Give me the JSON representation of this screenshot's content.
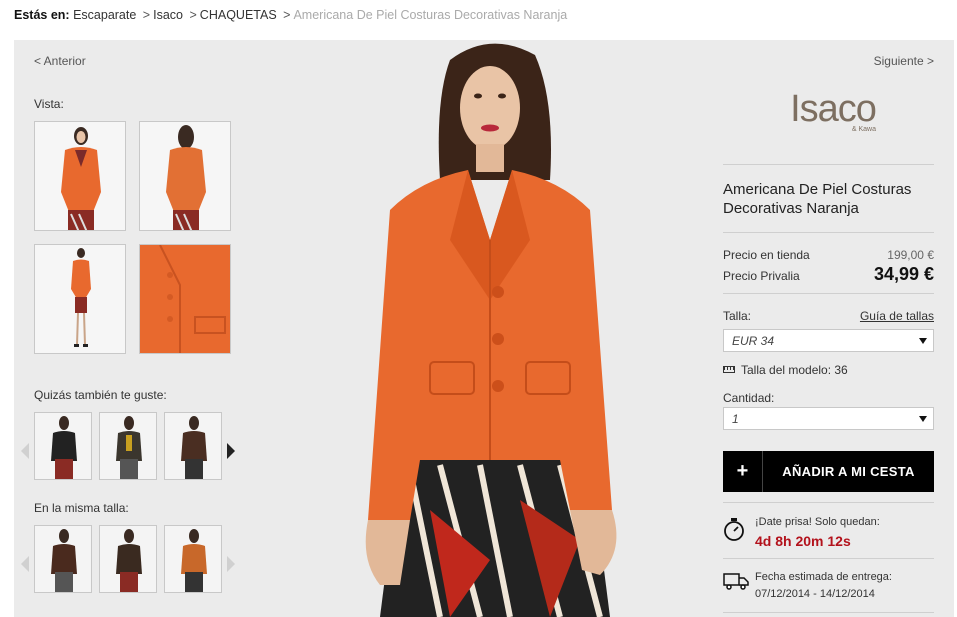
{
  "breadcrumb": {
    "prefix": "Estás en:",
    "items": [
      "Escaparate",
      "Isaco",
      "CHAQUETAS"
    ],
    "current": "Americana De Piel Costuras Decorativas Naranja",
    "separator": ">"
  },
  "nav": {
    "prev": "< Anterior",
    "next": "Siguiente >"
  },
  "gallery": {
    "label": "Vista:",
    "thumbnails": [
      "front-view",
      "back-view",
      "full-body-view",
      "detail-view"
    ]
  },
  "recommendations": {
    "label": "Quizás también te guste:",
    "items": [
      "black-jacket",
      "dark-jacket",
      "brown-jacket"
    ]
  },
  "same_size": {
    "label": "En la misma talla:",
    "items": [
      "brown-jacket",
      "dark-brown-jacket",
      "orange-jacket"
    ]
  },
  "brand": {
    "name": "Isaco",
    "sub": "& Kawa"
  },
  "product": {
    "title": "Americana De Piel Costuras Decorativas Naranja"
  },
  "pricing": {
    "store_label": "Precio en tienda",
    "store_value": "199,00 €",
    "privalia_label": "Precio Privalia",
    "privalia_value": "34,99 €"
  },
  "size": {
    "label": "Talla:",
    "guide": "Guía de tallas",
    "selected": "EUR 34",
    "model_size": "Talla del modelo: 36"
  },
  "quantity": {
    "label": "Cantidad:",
    "selected": "1"
  },
  "cart": {
    "plus": "+",
    "label": "AÑADIR A MI CESTA"
  },
  "urgency": {
    "text": "¡Date prisa! Solo quedan:",
    "countdown": "4d 8h 20m 12s"
  },
  "delivery": {
    "label": "Fecha estimada de entrega:",
    "dates": "07/12/2014 - 14/12/2014"
  },
  "colors": {
    "panel_bg": "#ebebeb",
    "jacket": "#e8692e",
    "countdown": "#b3121c",
    "brand": "#7d6f61"
  }
}
